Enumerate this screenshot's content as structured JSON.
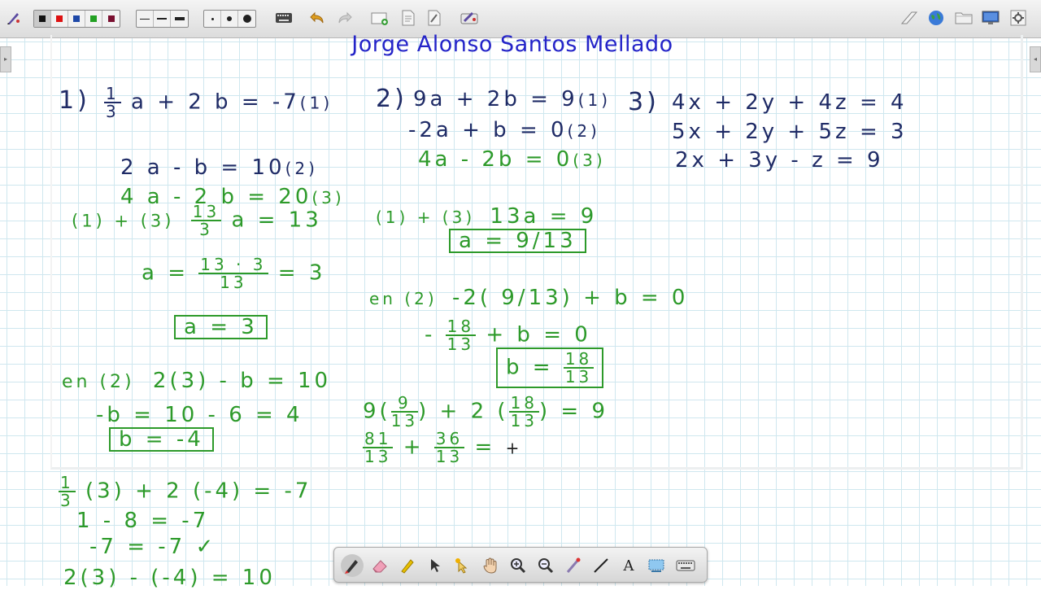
{
  "toolbar": {
    "colors": [
      "#111111",
      "#dd1111",
      "#1f49a8",
      "#22a022",
      "#7a1030"
    ],
    "selected_color": 0,
    "line_widths": [
      "thin",
      "medium",
      "thick"
    ],
    "dot_sizes": [
      "small",
      "medium",
      "large"
    ],
    "left_icons": [
      "pen-settings-icon",
      "keyboard-icon",
      "undo-icon",
      "redo-icon",
      "add-page-icon",
      "page-icon",
      "page-alt-icon",
      "tools-icon"
    ],
    "right_icons": [
      "eraser-icon",
      "web-icon",
      "folder-icon",
      "display-icon",
      "settings-icon"
    ]
  },
  "board": {
    "title": "Jorge Alonso Santos Mellado",
    "problems": {
      "p1": {
        "label": "1)",
        "eq1_a": "1",
        "eq1_b": "3",
        "eq1_rest": "a + 2 b = -7",
        "eq1_tag": "(1)",
        "eq2": "2 a - b = 10",
        "eq2_tag": "(2)",
        "eq3": "4 a - 2 b = 20",
        "eq3_tag": "(3)"
      },
      "p2": {
        "label": "2)",
        "eq1": "9a + 2b = 9",
        "eq1_tag": "(1)",
        "eq2": "-2a + b = 0",
        "eq2_tag": "(2)",
        "eq3": "4a - 2b = 0",
        "eq3_tag": "(3)"
      },
      "p3": {
        "label": "3)",
        "eq1": "4x + 2y + 4z = 4",
        "eq2": "5x + 2y + 5z = 3",
        "eq3": "2x + 3y - z = 9"
      }
    },
    "solution1": {
      "step1_label": "(1) + (3)",
      "step1_num": "13",
      "step1_den": "3",
      "step1_rest": "a = 13",
      "step2_lhs": "a =",
      "step2_num": "13 · 3",
      "step2_den": "13",
      "step2_rhs": "= 3",
      "result_a": "a = 3",
      "step3_label": "en (2)",
      "step3": "2(3) - b = 10",
      "step4": "-b = 10 - 6 = 4",
      "result_b": "b = -4",
      "check1_num": "1",
      "check1_den": "3",
      "check1_rest": "(3) + 2 (-4) = -7",
      "check2": "1 - 8 = -7",
      "check3": "-7 = -7",
      "check_mark": "✓",
      "check4": "2(3) - (-4) = 10"
    },
    "solution2": {
      "step1_label": "(1) + (3)",
      "step1": "13a = 9",
      "result_a": "a = 9/13",
      "step2_label": "en (2)",
      "step2": "-2( 9/13) + b = 0",
      "step3_minus": "-",
      "step3_num": "18",
      "step3_den": "13",
      "step3_rest": "+ b = 0",
      "result_b_lhs": "b =",
      "result_b_num": "18",
      "result_b_den": "13",
      "step4_a": "9(",
      "step4_n1": "9",
      "step4_d1": "13",
      "step4_b": ") + 2 (",
      "step4_n2": "18",
      "step4_d2": "13",
      "step4_c": ") = 9",
      "step5_n1": "81",
      "step5_d1": "13",
      "step5_plus": "+",
      "step5_n2": "36",
      "step5_d2": "13",
      "step5_eq": "=",
      "cursor": "+"
    }
  },
  "palette": {
    "tools": [
      "pen-icon",
      "eraser-icon",
      "highlighter-icon",
      "pointer-icon",
      "laser-pointer-icon",
      "hand-icon",
      "zoom-in-icon",
      "zoom-out-icon",
      "pointer-tool-icon",
      "line-icon",
      "text-icon",
      "capture-icon",
      "keyboard-icon"
    ],
    "text_tool_label": "A",
    "active_tool": "pen-icon"
  }
}
